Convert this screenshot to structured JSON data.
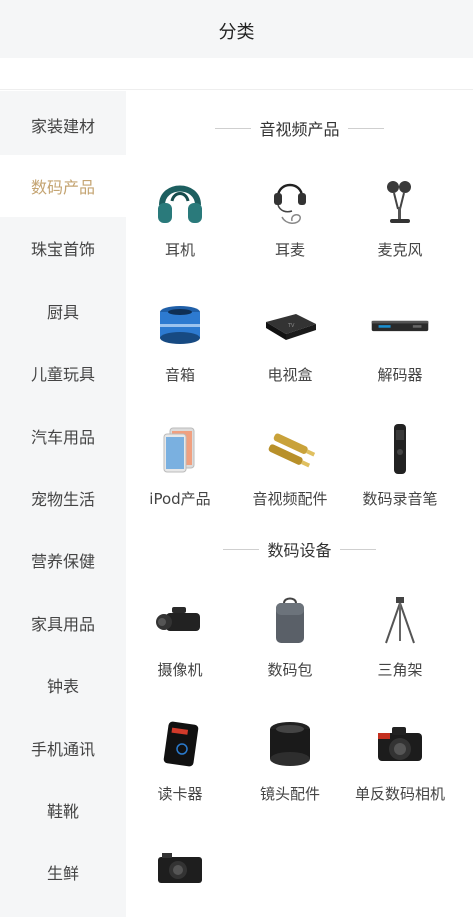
{
  "header": {
    "title": "分类"
  },
  "sidebar": {
    "items": [
      {
        "label": "家装建材"
      },
      {
        "label": "数码产品"
      },
      {
        "label": "珠宝首饰"
      },
      {
        "label": "厨具"
      },
      {
        "label": "儿童玩具"
      },
      {
        "label": "汽车用品"
      },
      {
        "label": "宠物生活"
      },
      {
        "label": "营养保健"
      },
      {
        "label": "家具用品"
      },
      {
        "label": "钟表"
      },
      {
        "label": "手机通讯"
      },
      {
        "label": "鞋靴"
      },
      {
        "label": "生鲜"
      }
    ],
    "active_index": 1
  },
  "sections": [
    {
      "title": "音视频产品",
      "items": [
        {
          "label": "耳机",
          "icon": "headphones-icon"
        },
        {
          "label": "耳麦",
          "icon": "headset-icon"
        },
        {
          "label": "麦克风",
          "icon": "microphone-icon"
        },
        {
          "label": "音箱",
          "icon": "speaker-icon"
        },
        {
          "label": "电视盒",
          "icon": "tv-box-icon"
        },
        {
          "label": "解码器",
          "icon": "decoder-icon"
        },
        {
          "label": "iPod产品",
          "icon": "ipod-icon"
        },
        {
          "label": "音视频配件",
          "icon": "av-cable-icon"
        },
        {
          "label": "数码录音笔",
          "icon": "voice-recorder-icon"
        }
      ]
    },
    {
      "title": "数码设备",
      "items": [
        {
          "label": "摄像机",
          "icon": "camcorder-icon"
        },
        {
          "label": "数码包",
          "icon": "camera-bag-icon"
        },
        {
          "label": "三角架",
          "icon": "tripod-icon"
        },
        {
          "label": "读卡器",
          "icon": "card-reader-icon"
        },
        {
          "label": "镜头配件",
          "icon": "lens-icon"
        },
        {
          "label": "单反数码相机",
          "icon": "dslr-camera-icon"
        },
        {
          "label": "",
          "icon": "compact-camera-icon"
        }
      ]
    }
  ],
  "colors": {
    "accent": "#c4a472",
    "sidebar_bg": "#f5f6f7"
  }
}
